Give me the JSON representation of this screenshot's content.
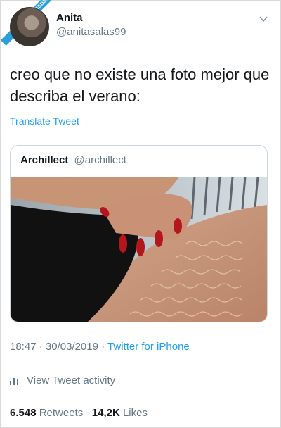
{
  "author": {
    "display_name": "Anita",
    "handle": "@anitasalas99"
  },
  "watermark_text": "VISTOENLASREDES.COM",
  "tweet": {
    "text": "creo que no existe una foto mejor que describa el verano:",
    "translate_label": "Translate Tweet"
  },
  "quoted": {
    "display_name": "Archillect",
    "handle": "@archillect"
  },
  "meta": {
    "time": "18:47",
    "date": "30/03/2019",
    "source": "Twitter for iPhone"
  },
  "activity_label": "View Tweet activity",
  "stats": {
    "retweets_count": "6.548",
    "retweets_label": "Retweets",
    "likes_count": "14,2K",
    "likes_label": "Likes"
  },
  "colors": {
    "link": "#1da1f2",
    "secondary_text": "#657786",
    "nail_red": "#b3161b"
  },
  "icons": [
    "chevron-down-icon",
    "bar-chart-icon"
  ]
}
